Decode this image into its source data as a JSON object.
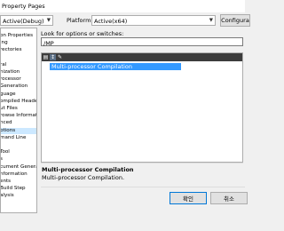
{
  "window": {
    "title": "Property Pages"
  },
  "config": {
    "value": "Active(Debug)"
  },
  "platform": {
    "label": "Platform:",
    "value": "Active(x64)"
  },
  "config_manager": {
    "label": "Configura"
  },
  "tree": {
    "items": [
      {
        "label": "on Properties"
      },
      {
        "label": "ing"
      },
      {
        "label": "rectories"
      },
      {
        "label": ""
      },
      {
        "label": "ral"
      },
      {
        "label": "nization"
      },
      {
        "label": "rocessor"
      },
      {
        "label": "Generation"
      },
      {
        "label": "guage"
      },
      {
        "label": "ompiled Headers"
      },
      {
        "label": "ut Files"
      },
      {
        "label": "rowse Information"
      },
      {
        "label": "nced"
      },
      {
        "label": "ptions"
      },
      {
        "label": "mand Line"
      },
      {
        "label": ""
      },
      {
        "label": "Tool"
      },
      {
        "label": "s"
      },
      {
        "label": "cument Generator"
      },
      {
        "label": "nformation"
      },
      {
        "label": "ents"
      },
      {
        "label": "Build Step"
      },
      {
        "label": "alysis"
      }
    ],
    "selected_index": 13
  },
  "search": {
    "label": "Look for options or switches:",
    "value": "/MP"
  },
  "options": {
    "selected": "Multi-processor Compilation"
  },
  "toolbar": {
    "icons": [
      "categorized-icon",
      "alphabetical-icon",
      "wrench-icon"
    ]
  },
  "description": {
    "title": "Multi-processor Compilation",
    "text": "Multi-processor Compilation."
  },
  "buttons": {
    "ok": "확인",
    "cancel": "취소"
  }
}
